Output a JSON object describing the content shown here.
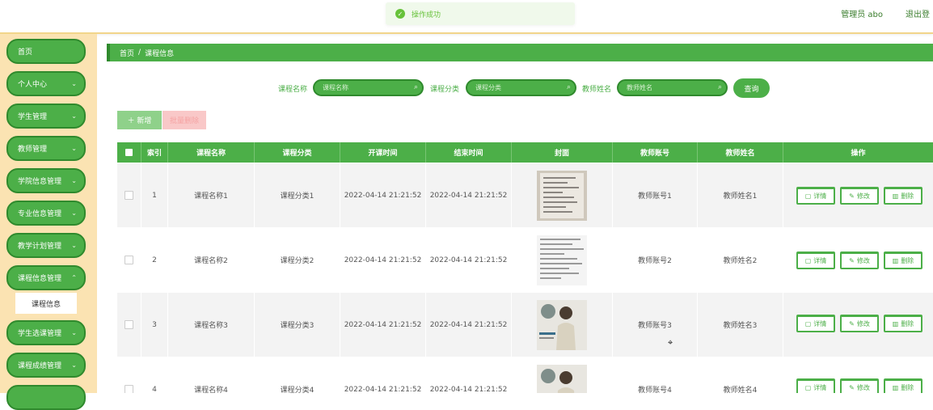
{
  "header": {
    "user_label": "管理员 abo",
    "logout": "退出登"
  },
  "toast": {
    "icon": "check-circle-icon",
    "message": "操作成功"
  },
  "sidebar": {
    "items": [
      {
        "label": "首页",
        "has_sub": false
      },
      {
        "label": "个人中心",
        "has_sub": true
      },
      {
        "label": "学生管理",
        "has_sub": true
      },
      {
        "label": "教师管理",
        "has_sub": true
      },
      {
        "label": "学院信息管理",
        "has_sub": true
      },
      {
        "label": "专业信息管理",
        "has_sub": true
      },
      {
        "label": "教学计划管理",
        "has_sub": true
      },
      {
        "label": "课程信息管理",
        "has_sub": true
      },
      {
        "label": "学生选课管理",
        "has_sub": true
      },
      {
        "label": "课程成绩管理",
        "has_sub": true
      }
    ],
    "active_sub": "课程信息"
  },
  "breadcrumb": {
    "home": "首页",
    "separator": "/",
    "current": "课程信息"
  },
  "search": {
    "course_name_label": "课程名称",
    "course_name_placeholder": "课程名称",
    "category_label": "课程分类",
    "category_placeholder": "课程分类",
    "teacher_label": "教师姓名",
    "teacher_placeholder": "教师姓名",
    "query_button": "查询"
  },
  "toolbar": {
    "add_label": "＋ 新增",
    "delete_label": "批量删除"
  },
  "table": {
    "columns": [
      "",
      "索引",
      "课程名称",
      "课程分类",
      "开课时间",
      "结束时间",
      "封面",
      "教师账号",
      "教师姓名",
      "操作"
    ],
    "rows": [
      {
        "index": "1",
        "name": "课程名称1",
        "category": "课程分类1",
        "start": "2022-04-14 21:21:52",
        "end": "2022-04-14 21:21:52",
        "teacher_account": "教师账号1",
        "teacher_name": "教师姓名1"
      },
      {
        "index": "2",
        "name": "课程名称2",
        "category": "课程分类2",
        "start": "2022-04-14 21:21:52",
        "end": "2022-04-14 21:21:52",
        "teacher_account": "教师账号2",
        "teacher_name": "教师姓名2"
      },
      {
        "index": "3",
        "name": "课程名称3",
        "category": "课程分类3",
        "start": "2022-04-14 21:21:52",
        "end": "2022-04-14 21:21:52",
        "teacher_account": "教师账号3",
        "teacher_name": "教师姓名3"
      },
      {
        "index": "4",
        "name": "课程名称4",
        "category": "课程分类4",
        "start": "2022-04-14 21:21:52",
        "end": "2022-04-14 21:21:52",
        "teacher_account": "教师账号4",
        "teacher_name": "教师姓名4"
      }
    ],
    "actions": {
      "detail": "详情",
      "edit": "修改",
      "delete": "删除"
    }
  },
  "colors": {
    "primary": "#4caf48",
    "primary_dark": "#2f8a2d",
    "sidebar_bg": "#fbe3b2",
    "danger_light": "#f9c8c8"
  }
}
